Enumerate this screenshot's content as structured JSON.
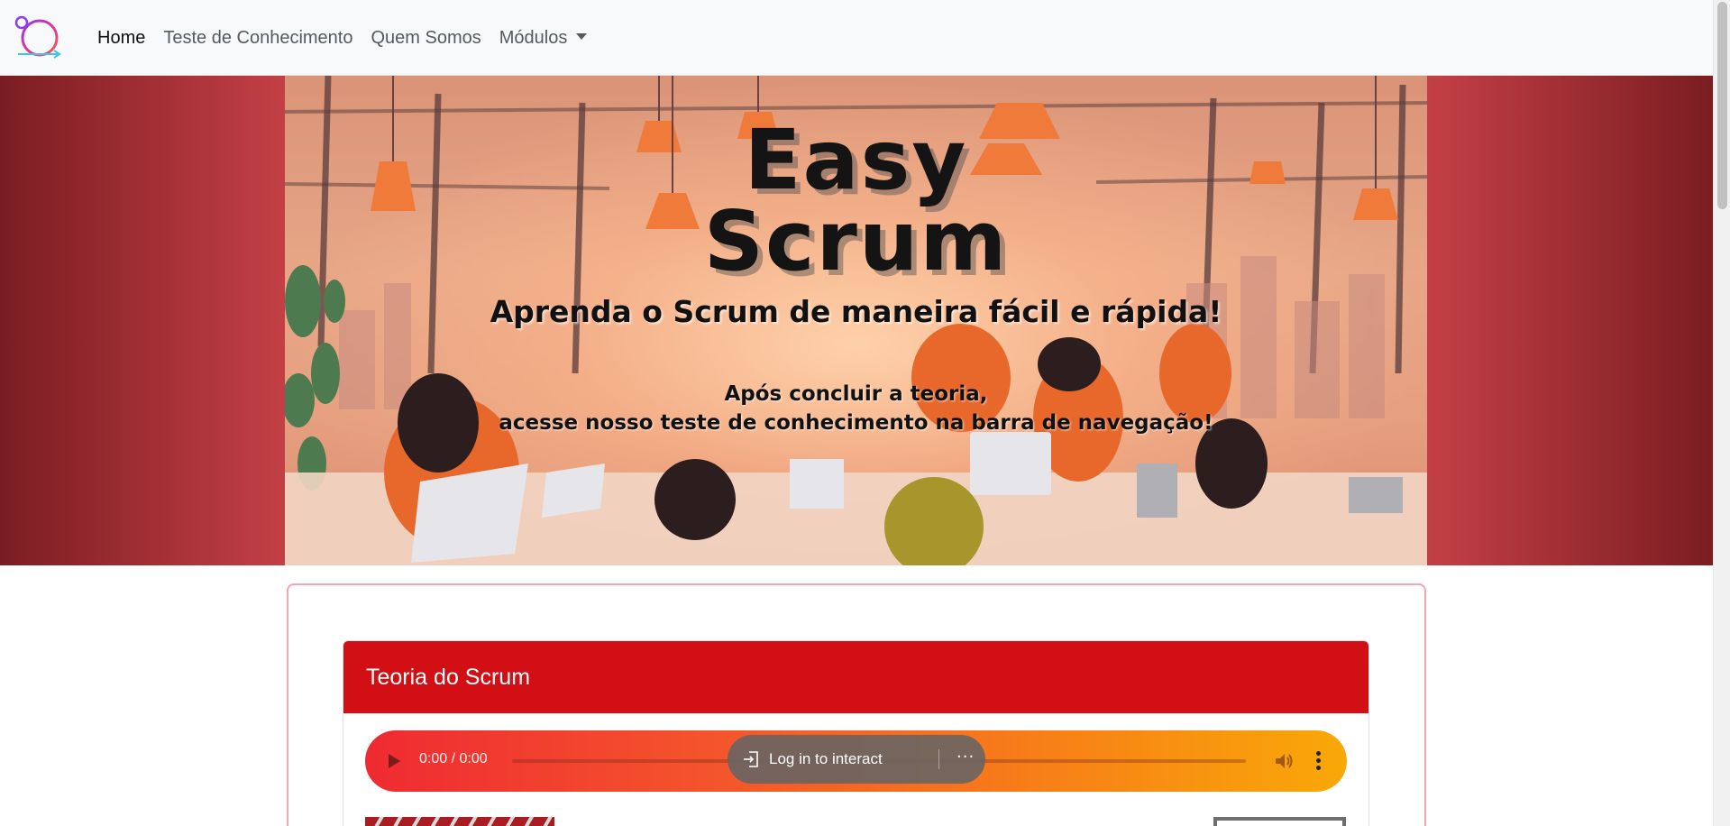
{
  "navbar": {
    "logo_icon": "easy-scrum-logo-icon",
    "items": [
      {
        "label": "Home",
        "active": true
      },
      {
        "label": "Teste de Conhecimento",
        "active": false
      },
      {
        "label": "Quem Somos",
        "active": false
      },
      {
        "label": "Módulos",
        "active": false,
        "dropdown": true
      }
    ]
  },
  "hero": {
    "title_line1": "Easy",
    "title_line2": "Scrum",
    "subtitle": "Aprenda o Scrum de maneira fácil e rápida!",
    "note_line1": "Após concluir a teoria,",
    "note_line2": "acesse nosso teste de conhecimento na barra de navegação!"
  },
  "card": {
    "title": "Teoria do Scrum"
  },
  "audio": {
    "time": "0:00 / 0:00",
    "login_label": "Log in to interact",
    "more_label": "···"
  },
  "colors": {
    "hero_background": "#c44146",
    "card_header": "#d20f14",
    "card_border": "#f2a6ae",
    "audio_gradient_start": "#ef2a32",
    "audio_gradient_end": "#f9a808"
  }
}
